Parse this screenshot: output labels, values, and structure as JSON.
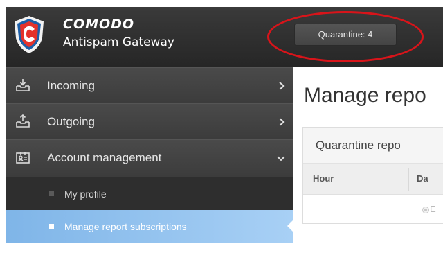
{
  "header": {
    "brand_name": "COMODO",
    "brand_product": "Antispam Gateway",
    "logo_icon": "comodo-shield-logo",
    "quarantine_button_label": "Quarantine: 4",
    "highlight_color": "#d8141a"
  },
  "sidebar": {
    "items": [
      {
        "label": "Incoming",
        "icon": "inbox-download-icon",
        "arrow": "chevron-right-icon"
      },
      {
        "label": "Outgoing",
        "icon": "inbox-upload-icon",
        "arrow": "chevron-right-icon"
      },
      {
        "label": "Account management",
        "icon": "account-card-icon",
        "arrow": "chevron-down-icon",
        "expanded": true
      }
    ],
    "subitems": [
      {
        "label": "My profile",
        "active": false
      },
      {
        "label": "Manage report subscriptions",
        "active": true
      }
    ],
    "active_color": "#8fc0ee"
  },
  "main": {
    "page_title": "Manage repo",
    "panel_title": "Quarantine repo",
    "columns": [
      "Hour",
      "Da"
    ],
    "radio_label": "E"
  }
}
